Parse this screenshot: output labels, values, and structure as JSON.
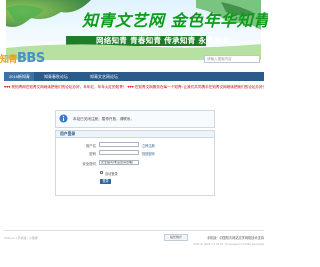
{
  "banner": {
    "line1": "知青文艺网 金色年华知青网",
    "line2": "网络知青 青春知青 传承知青 永不言老"
  },
  "logo": {
    "prefix": "知青",
    "text": "BBS"
  },
  "search": {
    "placeholder": "请输入搜索内容"
  },
  "nav": {
    "items": [
      {
        "label": "2018新知青"
      },
      {
        "label": "知青春秋论坛"
      },
      {
        "label": "知青文艺网论坛"
      }
    ]
  },
  "announcement": "♥♥♥ 祝知青网在知青文网继续把他们的论坛办好，年年红，年年火红的知青！ ♥♥♥ 在知青文网服务在每一个知青! 让我们共同携手在知青文网继续把我们的论坛办好！ ♥♥♥",
  "message": {
    "text": "本站已关闭注册，暂停开放，请联系。"
  },
  "login": {
    "title": "用户登录",
    "username_label": "用户名",
    "password_label": "密码",
    "register_link": "立即注册",
    "forgot_link": "找回密码",
    "question_label": "安全提问",
    "question_value": "安全提问(未设置请忽略)",
    "remember_label": "自动登录",
    "submit_label": "登录"
  },
  "footer": {
    "left_text": "Archiver | 手机版 | 小黑屋",
    "badge": "站长统计",
    "right_text": "手机版 · 中国知青网站文学网络技术支持",
    "sub_text": "GMT+8, 2024-7-1 13:04 , Processed in 0.0381 second(s)"
  },
  "colors": {
    "nav_bg": "#2b5b8b",
    "banner_green": "#0e9a1a",
    "announcement_red": "#cc0000",
    "login_button": "#2f64a0"
  }
}
